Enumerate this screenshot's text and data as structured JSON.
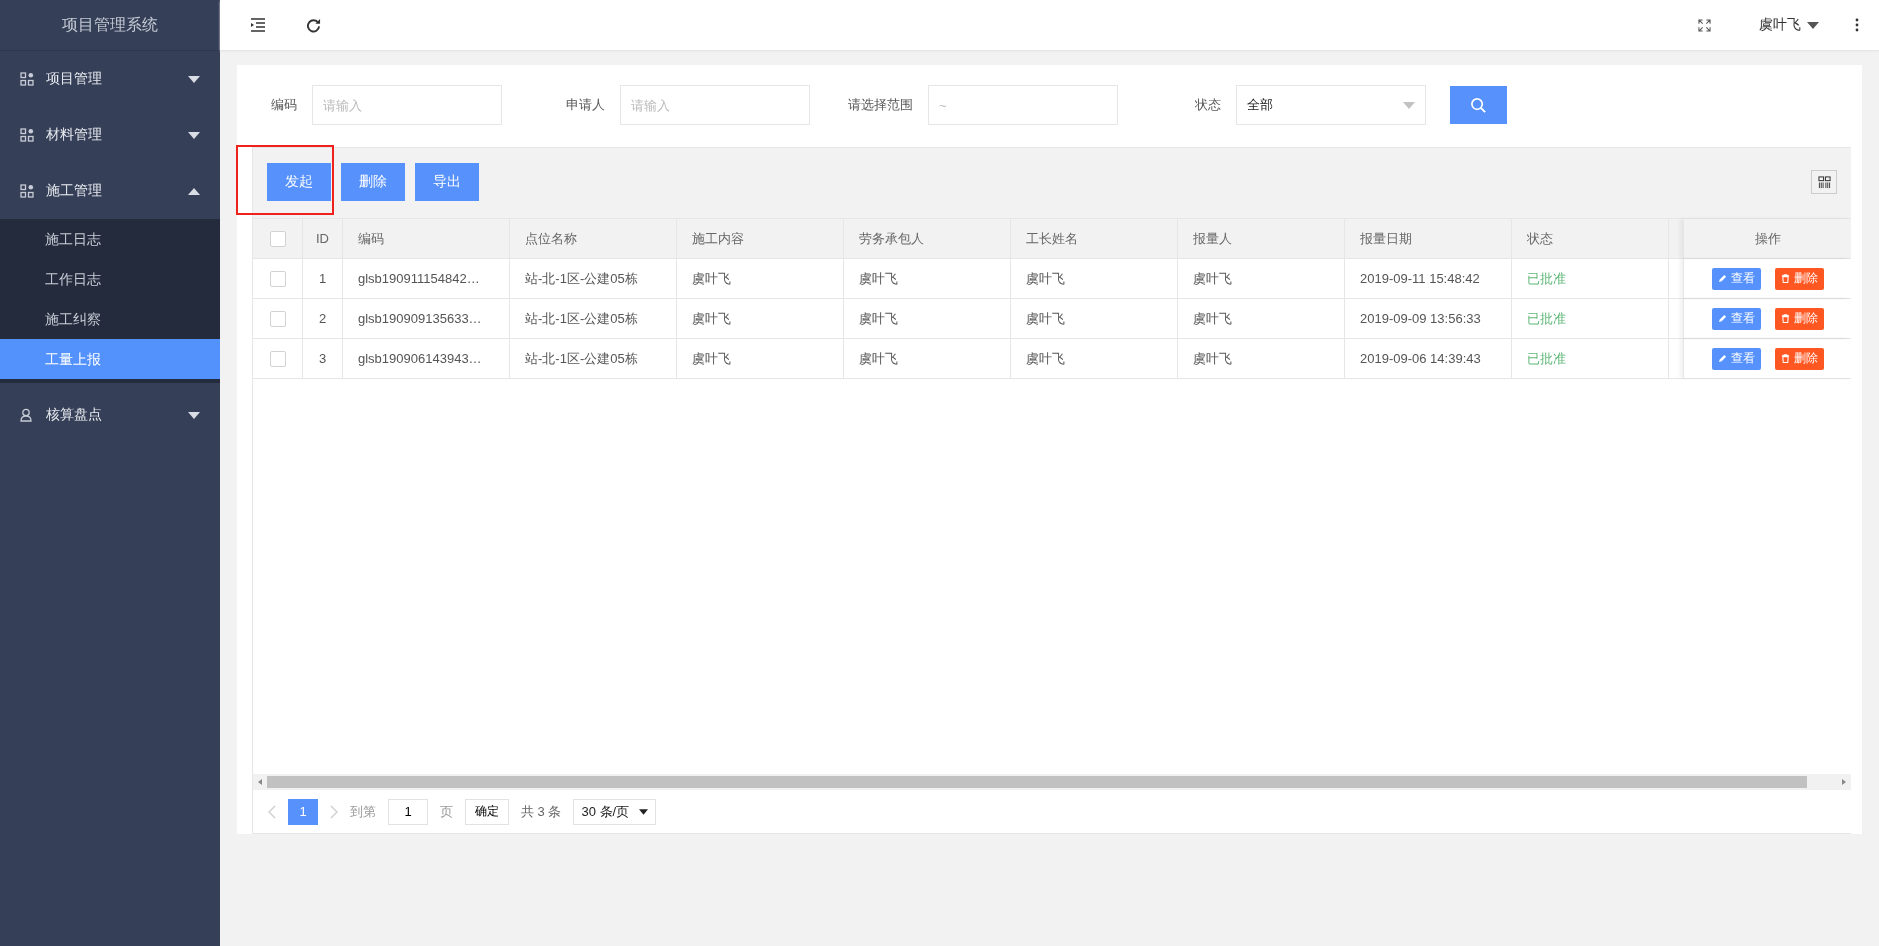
{
  "sidebar": {
    "title": "项目管理系统",
    "items": [
      {
        "label": "项目管理",
        "kind": "module",
        "expanded": false
      },
      {
        "label": "材料管理",
        "kind": "module",
        "expanded": false
      },
      {
        "label": "施工管理",
        "kind": "module",
        "expanded": true,
        "children": [
          {
            "label": "施工日志",
            "selected": false
          },
          {
            "label": "工作日志",
            "selected": false
          },
          {
            "label": "施工纠察",
            "selected": false
          },
          {
            "label": "工量上报",
            "selected": true
          }
        ]
      },
      {
        "label": "核算盘点",
        "kind": "account",
        "expanded": false
      }
    ]
  },
  "topbar": {
    "user": "虞叶飞"
  },
  "filters": [
    {
      "kind": "text",
      "label": "编码",
      "placeholder": "请输入"
    },
    {
      "kind": "text",
      "label": "申请人",
      "placeholder": "请输入"
    },
    {
      "kind": "range",
      "label": "请选择范围",
      "placeholder": "~"
    },
    {
      "kind": "select",
      "label": "状态",
      "value": "全部"
    }
  ],
  "actions": [
    {
      "label": "发起",
      "highlighted": true
    },
    {
      "label": "删除",
      "highlighted": false
    },
    {
      "label": "导出",
      "highlighted": false
    }
  ],
  "table": {
    "all_checked": false,
    "columns": [
      "ID",
      "编码",
      "点位名称",
      "施工内容",
      "劳务承包人",
      "工长姓名",
      "报量人",
      "报量日期",
      "状态",
      "操作"
    ],
    "rows": [
      {
        "checked": false,
        "cells": [
          "1",
          "glsb190911154842…",
          "站-北-1区-公建05栋",
          "虞叶飞",
          "虞叶飞",
          "虞叶飞",
          "虞叶飞",
          "2019-09-11 15:48:42"
        ],
        "status": "已批准",
        "actions": [
          "查看",
          "删除"
        ]
      },
      {
        "checked": false,
        "cells": [
          "2",
          "glsb190909135633…",
          "站-北-1区-公建05栋",
          "虞叶飞",
          "虞叶飞",
          "虞叶飞",
          "虞叶飞",
          "2019-09-09 13:56:33"
        ],
        "status": "已批准",
        "actions": [
          "查看",
          "删除"
        ]
      },
      {
        "checked": false,
        "cells": [
          "3",
          "glsb190906143943…",
          "站-北-1区-公建05栋",
          "虞叶飞",
          "虞叶飞",
          "虞叶飞",
          "虞叶飞",
          "2019-09-06 14:39:43"
        ],
        "status": "已批准",
        "actions": [
          "查看",
          "删除"
        ]
      }
    ]
  },
  "pagination": {
    "pages": [
      {
        "label": "1",
        "selected": true
      }
    ],
    "goto_label": "到第",
    "goto_value": "1",
    "page_unit": "页",
    "confirm": "确定",
    "total": "共 3 条",
    "page_size": "30 条/页"
  }
}
